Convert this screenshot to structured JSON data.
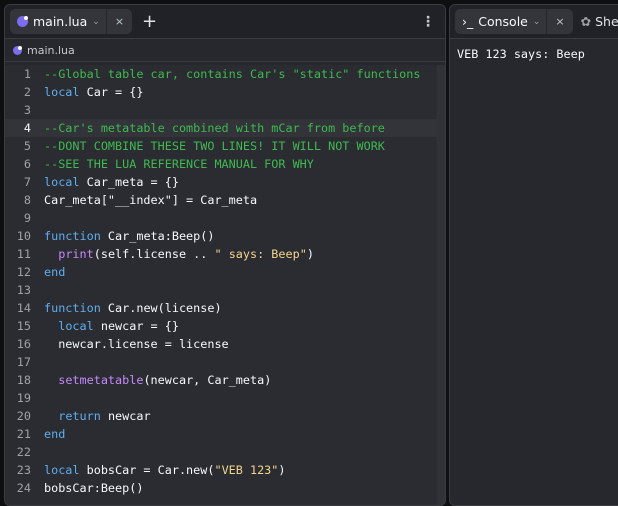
{
  "editor": {
    "tab_label": "main.lua",
    "breadcrumb": "main.lua",
    "current_line": 4,
    "lines": [
      [
        [
          "c",
          "--Global table car, contains Car's \"static\" functions"
        ]
      ],
      [
        [
          "k",
          "local"
        ],
        [
          "p",
          " Car = {}"
        ]
      ],
      [],
      [
        [
          "c",
          "--Car's metatable combined with mCar from before"
        ]
      ],
      [
        [
          "c",
          "--DONT COMBINE THESE TWO LINES! IT WILL NOT WORK"
        ]
      ],
      [
        [
          "c",
          "--SEE THE LUA REFERENCE MANUAL FOR WHY"
        ]
      ],
      [
        [
          "k",
          "local"
        ],
        [
          "p",
          " Car_meta = {}"
        ]
      ],
      [
        [
          "p",
          "Car_meta[\"__index\"] = Car_meta"
        ]
      ],
      [],
      [
        [
          "k",
          "function"
        ],
        [
          "p",
          " Car_meta:Beep()"
        ]
      ],
      [
        [
          "p",
          "  "
        ],
        [
          "f",
          "print"
        ],
        [
          "p",
          "(self.license .. "
        ],
        [
          "s",
          "\" says: Beep\""
        ],
        [
          "p",
          ")"
        ]
      ],
      [
        [
          "k",
          "end"
        ]
      ],
      [],
      [
        [
          "k",
          "function"
        ],
        [
          "p",
          " Car.new(license)"
        ]
      ],
      [
        [
          "p",
          "  "
        ],
        [
          "k",
          "local"
        ],
        [
          "p",
          " newcar = {}"
        ]
      ],
      [
        [
          "p",
          "  newcar.license = license"
        ]
      ],
      [],
      [
        [
          "p",
          "  "
        ],
        [
          "f",
          "setmetatable"
        ],
        [
          "p",
          "(newcar, Car_meta)"
        ]
      ],
      [],
      [
        [
          "p",
          "  "
        ],
        [
          "k",
          "return"
        ],
        [
          "p",
          " newcar"
        ]
      ],
      [
        [
          "k",
          "end"
        ]
      ],
      [],
      [
        [
          "k",
          "local"
        ],
        [
          "p",
          " bobsCar = Car.new("
        ],
        [
          "s",
          "\"VEB 123\""
        ],
        [
          "p",
          ")"
        ]
      ],
      [
        [
          "p",
          "bobsCar:Beep()"
        ]
      ]
    ]
  },
  "console": {
    "tab_label": "Console",
    "shell_label": "Shell",
    "output": "VEB 123 says: Beep"
  },
  "icons": {
    "close": "×",
    "plus": "+",
    "chevron": "⌄",
    "kebab": "⋮",
    "prompt": "›_",
    "shell": "✿"
  }
}
